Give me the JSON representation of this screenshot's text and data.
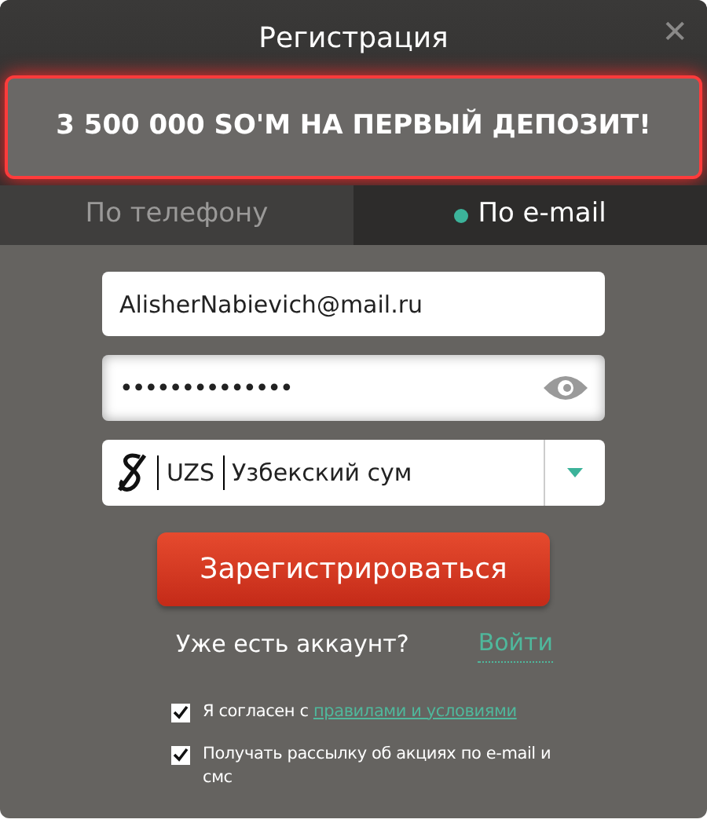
{
  "window": {
    "title": "Регистрация",
    "close": "✕"
  },
  "banner": "3 500 000 SO'M НА ПЕРВЫЙ ДЕПОЗИТ!",
  "tabs": [
    {
      "label": "По телефону",
      "selected": false
    },
    {
      "label": "По e-mail",
      "selected": true
    }
  ],
  "email": {
    "value": "AlisherNabievich@mail.ru"
  },
  "password": {
    "value": "••••••••••••••"
  },
  "currency": {
    "code": "UZS",
    "name": "Узбекский сум"
  },
  "submit": "Зарегистрироваться",
  "login": {
    "question": "Уже есть аккаунт?",
    "link": "Войти"
  },
  "checkboxes": [
    {
      "text": "Я согласен с ",
      "link": "правилами и условиями",
      "checked": true
    },
    {
      "text": "Получать рассылку об акциях по e-mail и смс",
      "checked": true
    }
  ]
}
